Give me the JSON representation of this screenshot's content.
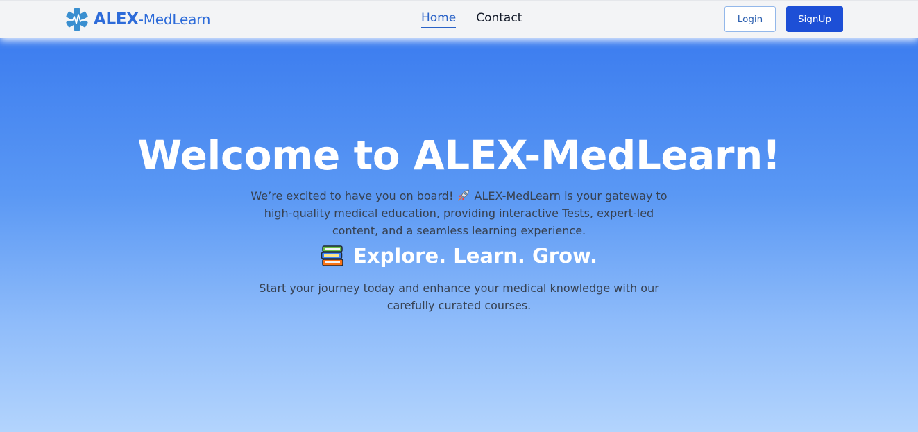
{
  "nav": {
    "brand_strong": "ALEX",
    "brand_light": "-MedLearn",
    "logo_icon": "star-of-life-icon",
    "links": [
      {
        "label": "Home",
        "active": true
      },
      {
        "label": "Contact",
        "active": false
      }
    ],
    "login_label": "Login",
    "signup_label": "SignUp"
  },
  "hero": {
    "title": "Welcome to ALEX-MedLearn!",
    "intro_before_emoji": "We’re excited to have you on board!",
    "intro_emoji": "rocket-icon",
    "intro_after_emoji": "ALEX-MedLearn is your gateway to high-quality medical education, providing interactive Tests, expert-led content, and a seamless learning experience.",
    "tagline_icon": "books-icon",
    "tagline": "Explore. Learn. Grow.",
    "subtext": "Start your journey today and enhance your medical knowledge with our carefully curated courses."
  },
  "colors": {
    "brand": "#2d6bd9",
    "signup_button": "#1d4fd6",
    "hero_gradient_top": "#3576ee",
    "hero_gradient_bottom": "#b3d4fd"
  }
}
